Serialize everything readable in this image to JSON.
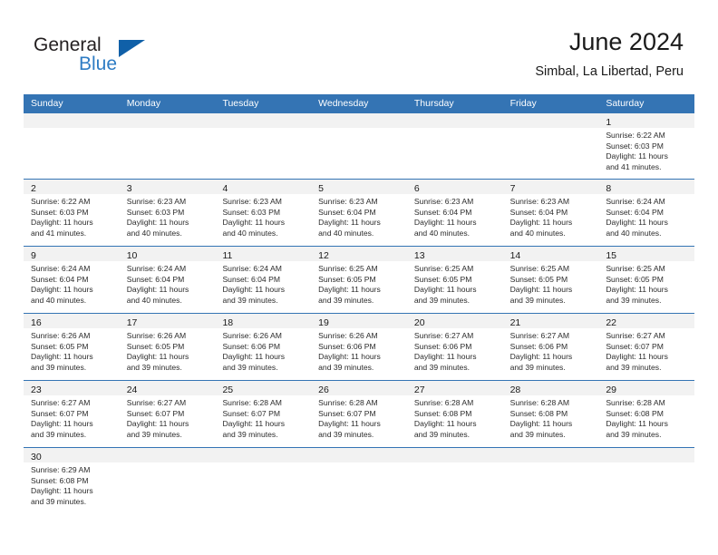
{
  "brand": {
    "name_part1": "General",
    "name_part2": "Blue",
    "colors": {
      "dark": "#231f20",
      "blue": "#2e7cc4",
      "triangle": "#1060a8"
    }
  },
  "header": {
    "title": "June 2024",
    "subtitle": "Simbal, La Libertad, Peru"
  },
  "theme": {
    "header_blue": "#3474b4",
    "daynum_bar": "#f2f2f2",
    "text": "#1a1a1a"
  },
  "calendar": {
    "day_names": [
      "Sunday",
      "Monday",
      "Tuesday",
      "Wednesday",
      "Thursday",
      "Friday",
      "Saturday"
    ],
    "weeks": [
      [
        {
          "day": "",
          "sunrise": "",
          "sunset": "",
          "daylight1": "",
          "daylight2": ""
        },
        {
          "day": "",
          "sunrise": "",
          "sunset": "",
          "daylight1": "",
          "daylight2": ""
        },
        {
          "day": "",
          "sunrise": "",
          "sunset": "",
          "daylight1": "",
          "daylight2": ""
        },
        {
          "day": "",
          "sunrise": "",
          "sunset": "",
          "daylight1": "",
          "daylight2": ""
        },
        {
          "day": "",
          "sunrise": "",
          "sunset": "",
          "daylight1": "",
          "daylight2": ""
        },
        {
          "day": "",
          "sunrise": "",
          "sunset": "",
          "daylight1": "",
          "daylight2": ""
        },
        {
          "day": "1",
          "sunrise": "Sunrise: 6:22 AM",
          "sunset": "Sunset: 6:03 PM",
          "daylight1": "Daylight: 11 hours",
          "daylight2": "and 41 minutes."
        }
      ],
      [
        {
          "day": "2",
          "sunrise": "Sunrise: 6:22 AM",
          "sunset": "Sunset: 6:03 PM",
          "daylight1": "Daylight: 11 hours",
          "daylight2": "and 41 minutes."
        },
        {
          "day": "3",
          "sunrise": "Sunrise: 6:23 AM",
          "sunset": "Sunset: 6:03 PM",
          "daylight1": "Daylight: 11 hours",
          "daylight2": "and 40 minutes."
        },
        {
          "day": "4",
          "sunrise": "Sunrise: 6:23 AM",
          "sunset": "Sunset: 6:03 PM",
          "daylight1": "Daylight: 11 hours",
          "daylight2": "and 40 minutes."
        },
        {
          "day": "5",
          "sunrise": "Sunrise: 6:23 AM",
          "sunset": "Sunset: 6:04 PM",
          "daylight1": "Daylight: 11 hours",
          "daylight2": "and 40 minutes."
        },
        {
          "day": "6",
          "sunrise": "Sunrise: 6:23 AM",
          "sunset": "Sunset: 6:04 PM",
          "daylight1": "Daylight: 11 hours",
          "daylight2": "and 40 minutes."
        },
        {
          "day": "7",
          "sunrise": "Sunrise: 6:23 AM",
          "sunset": "Sunset: 6:04 PM",
          "daylight1": "Daylight: 11 hours",
          "daylight2": "and 40 minutes."
        },
        {
          "day": "8",
          "sunrise": "Sunrise: 6:24 AM",
          "sunset": "Sunset: 6:04 PM",
          "daylight1": "Daylight: 11 hours",
          "daylight2": "and 40 minutes."
        }
      ],
      [
        {
          "day": "9",
          "sunrise": "Sunrise: 6:24 AM",
          "sunset": "Sunset: 6:04 PM",
          "daylight1": "Daylight: 11 hours",
          "daylight2": "and 40 minutes."
        },
        {
          "day": "10",
          "sunrise": "Sunrise: 6:24 AM",
          "sunset": "Sunset: 6:04 PM",
          "daylight1": "Daylight: 11 hours",
          "daylight2": "and 40 minutes."
        },
        {
          "day": "11",
          "sunrise": "Sunrise: 6:24 AM",
          "sunset": "Sunset: 6:04 PM",
          "daylight1": "Daylight: 11 hours",
          "daylight2": "and 39 minutes."
        },
        {
          "day": "12",
          "sunrise": "Sunrise: 6:25 AM",
          "sunset": "Sunset: 6:05 PM",
          "daylight1": "Daylight: 11 hours",
          "daylight2": "and 39 minutes."
        },
        {
          "day": "13",
          "sunrise": "Sunrise: 6:25 AM",
          "sunset": "Sunset: 6:05 PM",
          "daylight1": "Daylight: 11 hours",
          "daylight2": "and 39 minutes."
        },
        {
          "day": "14",
          "sunrise": "Sunrise: 6:25 AM",
          "sunset": "Sunset: 6:05 PM",
          "daylight1": "Daylight: 11 hours",
          "daylight2": "and 39 minutes."
        },
        {
          "day": "15",
          "sunrise": "Sunrise: 6:25 AM",
          "sunset": "Sunset: 6:05 PM",
          "daylight1": "Daylight: 11 hours",
          "daylight2": "and 39 minutes."
        }
      ],
      [
        {
          "day": "16",
          "sunrise": "Sunrise: 6:26 AM",
          "sunset": "Sunset: 6:05 PM",
          "daylight1": "Daylight: 11 hours",
          "daylight2": "and 39 minutes."
        },
        {
          "day": "17",
          "sunrise": "Sunrise: 6:26 AM",
          "sunset": "Sunset: 6:05 PM",
          "daylight1": "Daylight: 11 hours",
          "daylight2": "and 39 minutes."
        },
        {
          "day": "18",
          "sunrise": "Sunrise: 6:26 AM",
          "sunset": "Sunset: 6:06 PM",
          "daylight1": "Daylight: 11 hours",
          "daylight2": "and 39 minutes."
        },
        {
          "day": "19",
          "sunrise": "Sunrise: 6:26 AM",
          "sunset": "Sunset: 6:06 PM",
          "daylight1": "Daylight: 11 hours",
          "daylight2": "and 39 minutes."
        },
        {
          "day": "20",
          "sunrise": "Sunrise: 6:27 AM",
          "sunset": "Sunset: 6:06 PM",
          "daylight1": "Daylight: 11 hours",
          "daylight2": "and 39 minutes."
        },
        {
          "day": "21",
          "sunrise": "Sunrise: 6:27 AM",
          "sunset": "Sunset: 6:06 PM",
          "daylight1": "Daylight: 11 hours",
          "daylight2": "and 39 minutes."
        },
        {
          "day": "22",
          "sunrise": "Sunrise: 6:27 AM",
          "sunset": "Sunset: 6:07 PM",
          "daylight1": "Daylight: 11 hours",
          "daylight2": "and 39 minutes."
        }
      ],
      [
        {
          "day": "23",
          "sunrise": "Sunrise: 6:27 AM",
          "sunset": "Sunset: 6:07 PM",
          "daylight1": "Daylight: 11 hours",
          "daylight2": "and 39 minutes."
        },
        {
          "day": "24",
          "sunrise": "Sunrise: 6:27 AM",
          "sunset": "Sunset: 6:07 PM",
          "daylight1": "Daylight: 11 hours",
          "daylight2": "and 39 minutes."
        },
        {
          "day": "25",
          "sunrise": "Sunrise: 6:28 AM",
          "sunset": "Sunset: 6:07 PM",
          "daylight1": "Daylight: 11 hours",
          "daylight2": "and 39 minutes."
        },
        {
          "day": "26",
          "sunrise": "Sunrise: 6:28 AM",
          "sunset": "Sunset: 6:07 PM",
          "daylight1": "Daylight: 11 hours",
          "daylight2": "and 39 minutes."
        },
        {
          "day": "27",
          "sunrise": "Sunrise: 6:28 AM",
          "sunset": "Sunset: 6:08 PM",
          "daylight1": "Daylight: 11 hours",
          "daylight2": "and 39 minutes."
        },
        {
          "day": "28",
          "sunrise": "Sunrise: 6:28 AM",
          "sunset": "Sunset: 6:08 PM",
          "daylight1": "Daylight: 11 hours",
          "daylight2": "and 39 minutes."
        },
        {
          "day": "29",
          "sunrise": "Sunrise: 6:28 AM",
          "sunset": "Sunset: 6:08 PM",
          "daylight1": "Daylight: 11 hours",
          "daylight2": "and 39 minutes."
        }
      ],
      [
        {
          "day": "30",
          "sunrise": "Sunrise: 6:29 AM",
          "sunset": "Sunset: 6:08 PM",
          "daylight1": "Daylight: 11 hours",
          "daylight2": "and 39 minutes."
        },
        {
          "day": "",
          "sunrise": "",
          "sunset": "",
          "daylight1": "",
          "daylight2": ""
        },
        {
          "day": "",
          "sunrise": "",
          "sunset": "",
          "daylight1": "",
          "daylight2": ""
        },
        {
          "day": "",
          "sunrise": "",
          "sunset": "",
          "daylight1": "",
          "daylight2": ""
        },
        {
          "day": "",
          "sunrise": "",
          "sunset": "",
          "daylight1": "",
          "daylight2": ""
        },
        {
          "day": "",
          "sunrise": "",
          "sunset": "",
          "daylight1": "",
          "daylight2": ""
        },
        {
          "day": "",
          "sunrise": "",
          "sunset": "",
          "daylight1": "",
          "daylight2": ""
        }
      ]
    ]
  }
}
